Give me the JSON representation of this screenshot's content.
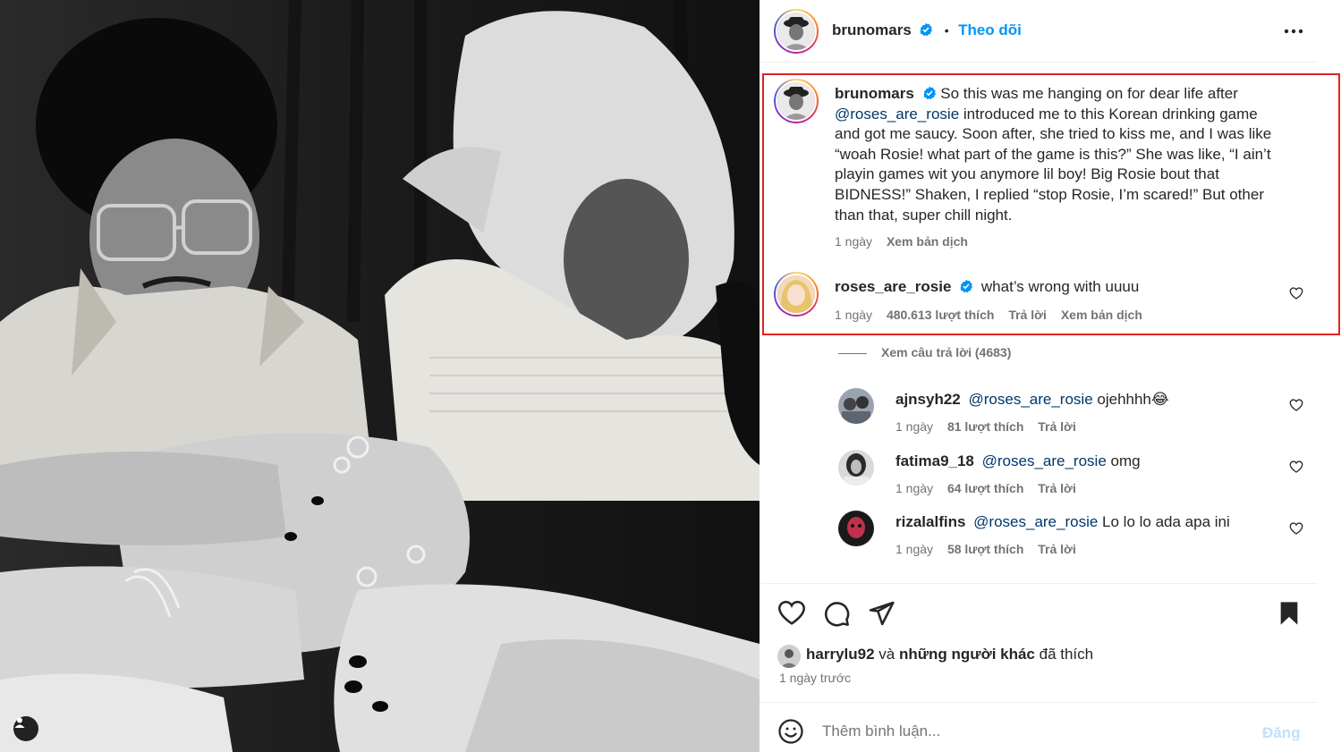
{
  "header": {
    "username": "brunomars",
    "dot": "•",
    "follow_label": "Theo dõi"
  },
  "caption": {
    "username": "brunomars",
    "text_1": "So this was me hanging on for dear life after",
    "mention": "@roses_are_rosie",
    "text_2": " introduced me to this Korean drinking game",
    "line_3": "and got me saucy. Soon after, she tried to kiss me, and I was like",
    "line_4": "“woah Rosie! what part of the game is this?” She was like, “I ain’t",
    "line_5": "playin games wit you anymore lil boy! Big Rosie bout that",
    "line_6": "BIDNESS!” Shaken, I replied “stop Rosie, I’m scared!” But other",
    "line_7": "than that, super chill night.",
    "time": "1 ngày",
    "translate": "Xem bản dịch"
  },
  "top_comment": {
    "username": "roses_are_rosie",
    "text": "what’s wrong with uuuu",
    "time": "1 ngày",
    "likes": "480.613 lượt thích",
    "reply": "Trả lời",
    "translate": "Xem bản dịch"
  },
  "view_replies": "Xem câu trả lời (4683)",
  "replies": [
    {
      "username": "ajnsyh22",
      "mention": "@roses_are_rosie",
      "text": " ojehhhh😂",
      "time": "1 ngày",
      "likes": "81 lượt thích",
      "reply": "Trả lời"
    },
    {
      "username": "fatima9_18",
      "mention": "@roses_are_rosie",
      "text": " omg",
      "time": "1 ngày",
      "likes": "64 lượt thích",
      "reply": "Trả lời"
    },
    {
      "username": "rizalalfins",
      "mention": "@roses_are_rosie",
      "text": " Lo lo lo ada apa ini",
      "time": "1 ngày",
      "likes": "58 lượt thích",
      "reply": "Trả lời"
    }
  ],
  "liked_by": {
    "user": "harrylu92",
    "and": " và ",
    "others": "những người khác",
    "suffix": " đã thích"
  },
  "post_time": "1 ngày trước",
  "add_comment": {
    "placeholder": "Thêm bình luận...",
    "post_label": "Đăng"
  },
  "colors": {
    "accent": "#0095f6",
    "highlight_border": "#e1231f",
    "mention": "#00376b",
    "muted": "#737373"
  },
  "icons": [
    "verified-icon",
    "more-options-icon",
    "heart-icon",
    "comment-icon",
    "share-icon",
    "bookmark-icon",
    "emoji-icon",
    "tag-user-icon"
  ]
}
